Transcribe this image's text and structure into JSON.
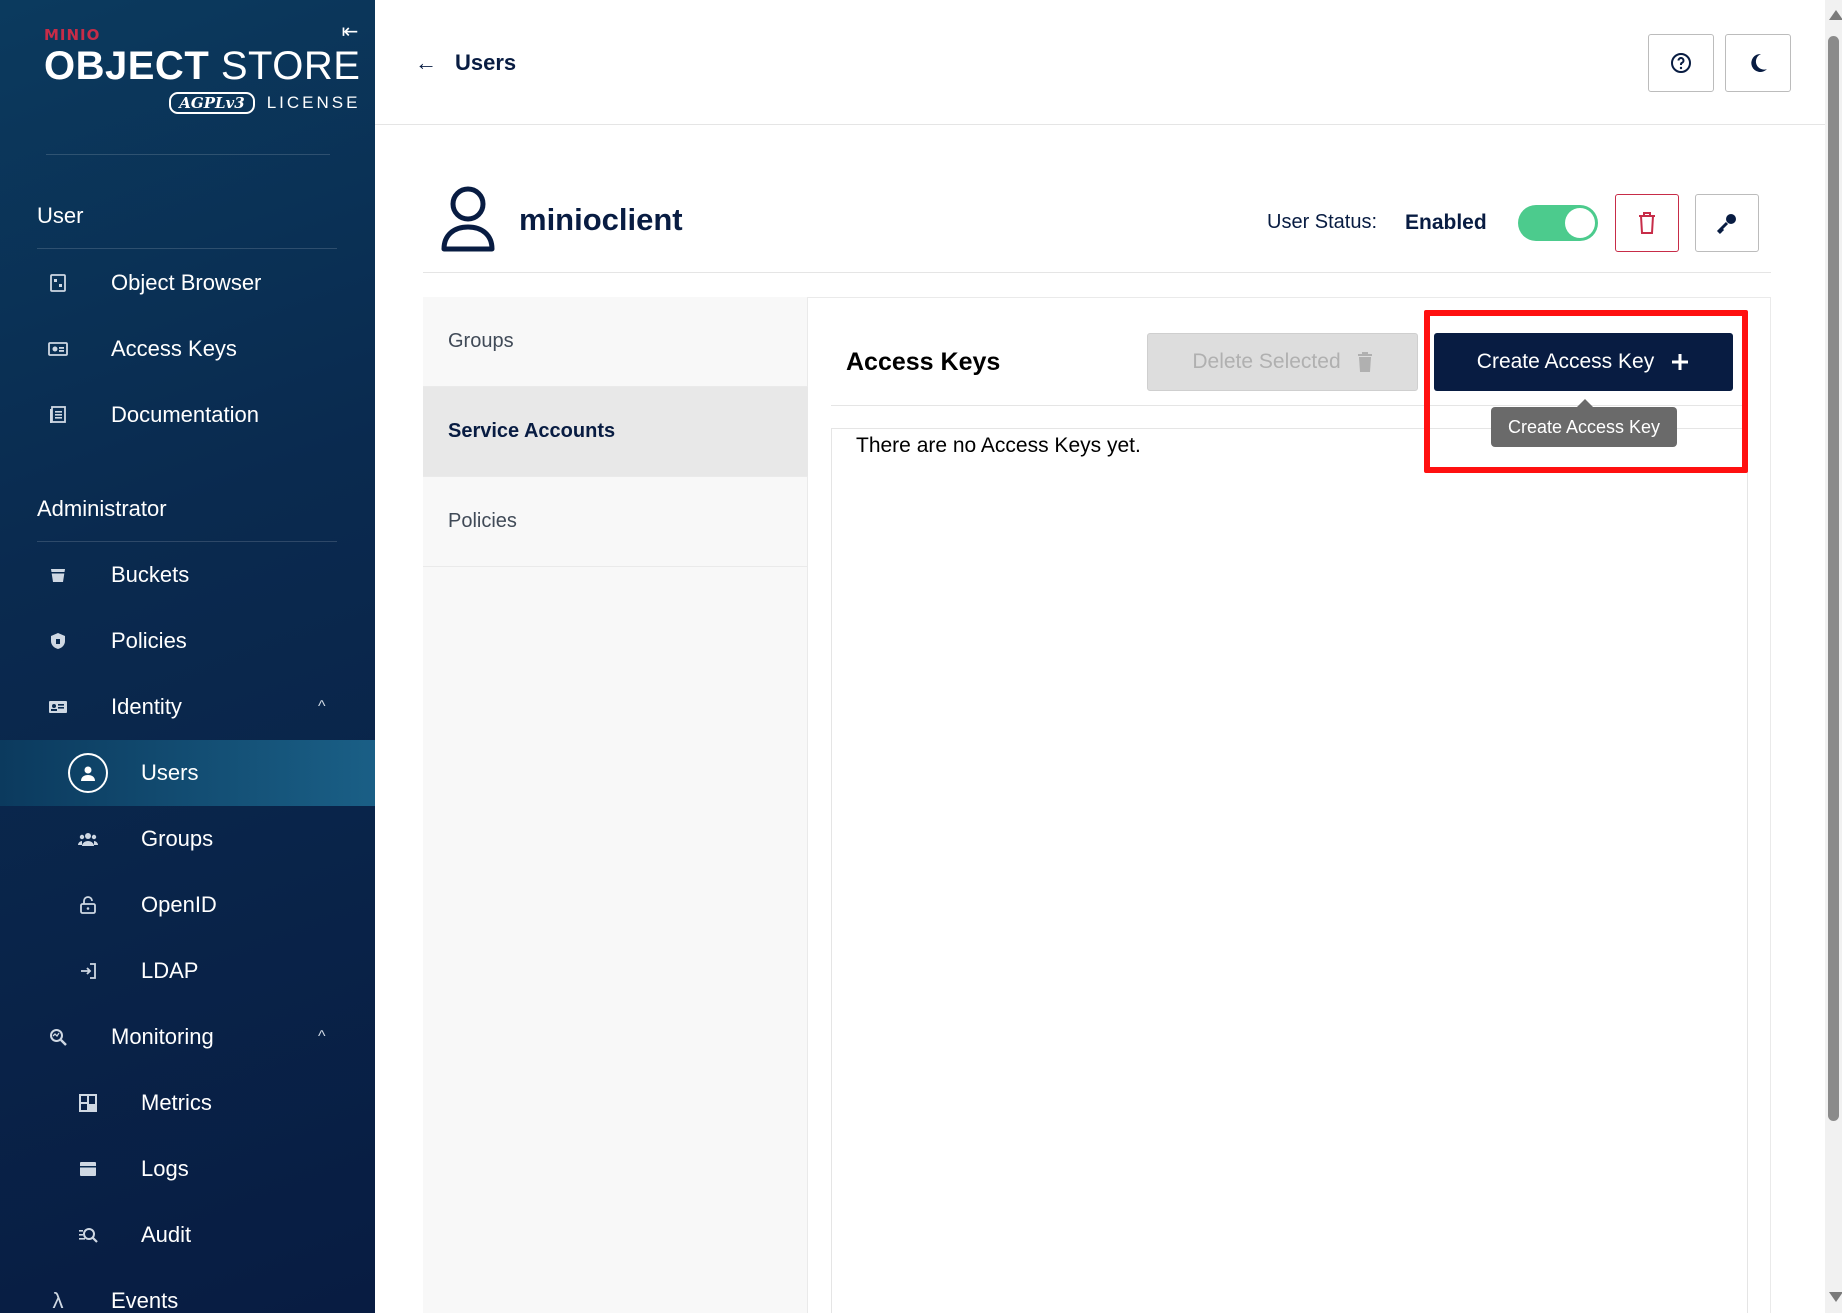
{
  "sidebar": {
    "brand": "MINIO",
    "product_bold": "OBJECT",
    "product_light": " STORE",
    "license_badge": "AGPLv3",
    "license_label": "LICENSE",
    "user_section": "User",
    "user_items": [
      {
        "label": "Object Browser",
        "icon": "object-browser-icon"
      },
      {
        "label": "Access Keys",
        "icon": "access-keys-icon"
      },
      {
        "label": "Documentation",
        "icon": "documentation-icon"
      }
    ],
    "admin_section": "Administrator",
    "admin_items": {
      "buckets": "Buckets",
      "policies": "Policies",
      "identity": "Identity",
      "users": "Users",
      "groups": "Groups",
      "openid": "OpenID",
      "ldap": "LDAP",
      "monitoring": "Monitoring",
      "metrics": "Metrics",
      "logs": "Logs",
      "audit": "Audit",
      "events": "Events"
    }
  },
  "header": {
    "back_label": "Users"
  },
  "user": {
    "name": "minioclient",
    "status_label": "User Status:",
    "status_value": "Enabled",
    "enabled": true
  },
  "tabs": [
    {
      "label": "Groups",
      "active": false
    },
    {
      "label": "Service Accounts",
      "active": true
    },
    {
      "label": "Policies",
      "active": false
    }
  ],
  "content": {
    "title": "Access Keys",
    "delete_label": "Delete Selected",
    "create_label": "Create Access Key",
    "empty_message": "There are no Access Keys yet.",
    "tooltip": "Create Access Key"
  },
  "colors": {
    "navy": "#081c42",
    "toggle_on": "#4ccb8d",
    "danger": "#c72c48",
    "highlight": "#ff1010"
  }
}
